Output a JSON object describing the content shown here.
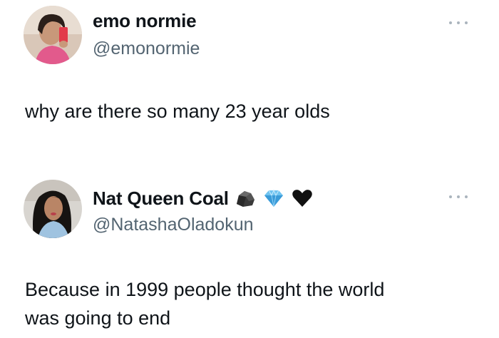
{
  "tweets": [
    {
      "name": "emo normie",
      "handle": "@emonormie",
      "text": "why are there so many 23 year olds",
      "more_icon": "more-icon"
    },
    {
      "name": "Nat Queen Coal",
      "handle": "@NatashaOladokun",
      "badges": [
        "coal-icon",
        "gem-icon",
        "black-heart-icon"
      ],
      "text_lines": [
        "Because in 1999 people thought the world",
        "was going to end"
      ],
      "more_icon": "more-icon"
    }
  ],
  "colors": {
    "text": "#0f1419",
    "secondary": "#536471",
    "background": "#ffffff"
  }
}
